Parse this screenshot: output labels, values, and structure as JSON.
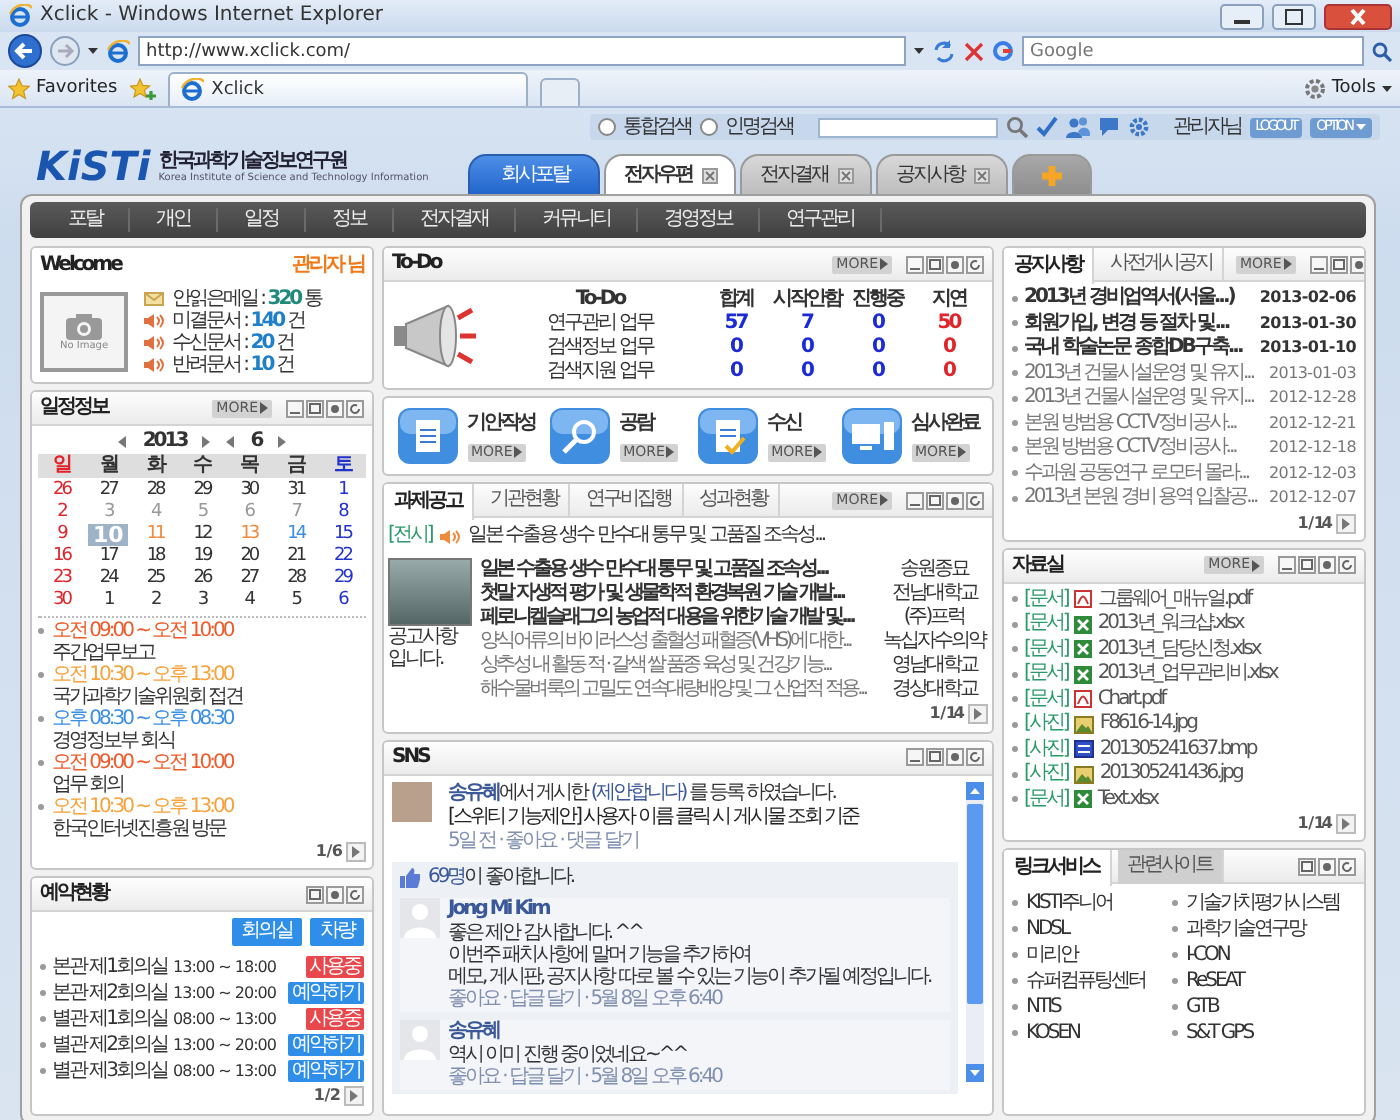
{
  "browser": {
    "title": "Xclick - Windows Internet Explorer",
    "address": "http://www.xclick.com/",
    "search_placeholder": "Google",
    "favorites": "Favorites",
    "tab": "Xclick",
    "tools": "Tools"
  },
  "topbar": {
    "search_options": [
      {
        "label": "통합검색",
        "selected": false
      },
      {
        "label": "인명검색",
        "selected": false
      }
    ],
    "user": "관리자님",
    "logout": "LOGOUT",
    "option": "OPTION"
  },
  "logo": {
    "mark": "KiSTi",
    "name": "한국과학기술정보연구원",
    "subtitle": "Korea Institute of Science and Technology Information"
  },
  "portal_tabs": [
    {
      "kind": "home",
      "label": "회사포탈",
      "selected": false
    },
    {
      "kind": "tab",
      "label": "전자우편",
      "selected": true
    },
    {
      "kind": "tab",
      "label": "전자결재",
      "selected": false
    },
    {
      "kind": "tab",
      "label": "공지사항",
      "selected": false
    },
    {
      "kind": "add"
    }
  ],
  "menu": [
    "포탈",
    "개인",
    "일정",
    "정보",
    "전자결재",
    "커뮤니티",
    "경영정보",
    "연구관리"
  ],
  "welcome": {
    "title": "Welcome",
    "user": "관리자 님",
    "photo_caption": "No Image",
    "stats": [
      {
        "kind": "mail",
        "label": "안읽은메일 : ",
        "value": "320",
        "unit": " 통",
        "color": "#1f8a7a"
      },
      {
        "kind": "speaker",
        "label": "미결문서 : ",
        "value": "140",
        "unit": " 건",
        "color": "#1f7fc8"
      },
      {
        "kind": "speaker",
        "label": "수신문서 : ",
        "value": "20",
        "unit": " 건",
        "color": "#1f7fc8"
      },
      {
        "kind": "speaker",
        "label": "반려문서 : ",
        "value": "10",
        "unit": " 건",
        "color": "#1f7fc8"
      }
    ]
  },
  "schedule": {
    "title": "일정정보",
    "more": "MORE",
    "year": "2013",
    "month": "6",
    "weekdays": [
      {
        "label": "일",
        "color": "#e0242b"
      },
      {
        "label": "월",
        "color": "#333333"
      },
      {
        "label": "화",
        "color": "#333333"
      },
      {
        "label": "수",
        "color": "#333333"
      },
      {
        "label": "목",
        "color": "#333333"
      },
      {
        "label": "금",
        "color": "#333333"
      },
      {
        "label": "토",
        "color": "#2233cc"
      }
    ],
    "weeks": [
      [
        {
          "day": "26",
          "color": "#e0242b",
          "selected": false
        },
        {
          "day": "27",
          "color": "#333333",
          "selected": false
        },
        {
          "day": "28",
          "color": "#333333",
          "selected": false
        },
        {
          "day": "29",
          "color": "#333333",
          "selected": false
        },
        {
          "day": "30",
          "color": "#333333",
          "selected": false
        },
        {
          "day": "31",
          "color": "#333333",
          "selected": false
        },
        {
          "day": "1",
          "color": "#2233cc",
          "selected": false
        }
      ],
      [
        {
          "day": "2",
          "color": "#e0242b",
          "selected": false
        },
        {
          "day": "3",
          "color": "#999999",
          "selected": false
        },
        {
          "day": "4",
          "color": "#999999",
          "selected": false
        },
        {
          "day": "5",
          "color": "#999999",
          "selected": false
        },
        {
          "day": "6",
          "color": "#999999",
          "selected": false
        },
        {
          "day": "7",
          "color": "#999999",
          "selected": false
        },
        {
          "day": "8",
          "color": "#2233cc",
          "selected": false
        }
      ],
      [
        {
          "day": "9",
          "color": "#e0242b",
          "selected": false
        },
        {
          "day": "10",
          "selected": true
        },
        {
          "day": "11",
          "color": "#f08a3c",
          "selected": false
        },
        {
          "day": "12",
          "color": "#333333",
          "selected": false
        },
        {
          "day": "13",
          "color": "#f08a3c",
          "selected": false
        },
        {
          "day": "14",
          "color": "#3a8ee6",
          "selected": false
        },
        {
          "day": "15",
          "color": "#2233cc",
          "selected": false
        }
      ],
      [
        {
          "day": "16",
          "color": "#e0242b",
          "selected": false
        },
        {
          "day": "17",
          "color": "#333333",
          "selected": false
        },
        {
          "day": "18",
          "color": "#333333",
          "selected": false
        },
        {
          "day": "19",
          "color": "#333333",
          "selected": false
        },
        {
          "day": "20",
          "color": "#333333",
          "selected": false
        },
        {
          "day": "21",
          "color": "#333333",
          "selected": false
        },
        {
          "day": "22",
          "color": "#2233cc",
          "selected": false
        }
      ],
      [
        {
          "day": "23",
          "color": "#e0242b",
          "selected": false
        },
        {
          "day": "24",
          "color": "#333333",
          "selected": false
        },
        {
          "day": "25",
          "color": "#333333",
          "selected": false
        },
        {
          "day": "26",
          "color": "#333333",
          "selected": false
        },
        {
          "day": "27",
          "color": "#333333",
          "selected": false
        },
        {
          "day": "28",
          "color": "#333333",
          "selected": false
        },
        {
          "day": "29",
          "color": "#2233cc",
          "selected": false
        }
      ],
      [
        {
          "day": "30",
          "color": "#e0242b",
          "selected": false
        },
        {
          "day": "1",
          "color": "#333333",
          "selected": false
        },
        {
          "day": "2",
          "color": "#333333",
          "selected": false
        },
        {
          "day": "3",
          "color": "#333333",
          "selected": false
        },
        {
          "day": "4",
          "color": "#333333",
          "selected": false
        },
        {
          "day": "5",
          "color": "#333333",
          "selected": false
        },
        {
          "day": "6",
          "color": "#2233cc",
          "selected": false
        }
      ]
    ],
    "events": [
      {
        "time": "오전 09:00 ~ 오전 10:00",
        "title": "주간업무보고",
        "color": "#f05a28"
      },
      {
        "time": "오전 10:30 ~ 오후 13:00",
        "title": "국가과학기술위원회 접견",
        "color": "#f7a23b"
      },
      {
        "time": "오후 08:30 ~ 오후 08:30",
        "title": "경영정보부 회식",
        "color": "#3a8ee6"
      },
      {
        "time": "오전 09:00 ~ 오전 10:00",
        "title": "업무 회의",
        "color": "#f05a28"
      },
      {
        "time": "오전 10:30 ~ 오후 13:00",
        "title": "한국인터넷진흥원 방문",
        "color": "#f7a23b"
      }
    ],
    "pager": "1 / 6"
  },
  "reservations": {
    "title": "예약현황",
    "buttons": [
      "회의실",
      "차량"
    ],
    "items": [
      {
        "room": "본관 제1회의실",
        "time": "13:00 ~ 18:00",
        "status": "사용중",
        "kind": "busy"
      },
      {
        "room": "본관 제2회의실",
        "time": "13:00 ~ 20:00",
        "status": "예약하기",
        "kind": "free"
      },
      {
        "room": "별관 제1회의실",
        "time": "08:00 ~ 13:00",
        "status": "사용중",
        "kind": "busy"
      },
      {
        "room": "별관 제2회의실",
        "time": "13:00 ~ 20:00",
        "status": "예약하기",
        "kind": "free"
      },
      {
        "room": "별관 제3회의실",
        "time": "08:00 ~ 13:00",
        "status": "예약하기",
        "kind": "free"
      }
    ],
    "pager": "1 / 2"
  },
  "todo": {
    "title": "To-Do",
    "more": "MORE",
    "header": "To-Do",
    "columns": [
      {
        "label": "합계",
        "color": "#1a2bd6"
      },
      {
        "label": "시작안함",
        "color": "#1a2bd6"
      },
      {
        "label": "진행중",
        "color": "#1a2bd6"
      },
      {
        "label": "지연",
        "color": "#e0242b"
      }
    ],
    "rows": [
      {
        "label": "연구관리 업무",
        "values": [
          "57",
          "7",
          "0",
          "50"
        ]
      },
      {
        "label": "검색정보 업무",
        "values": [
          "0",
          "0",
          "0",
          "0"
        ]
      },
      {
        "label": "검색지원 업무",
        "values": [
          "0",
          "0",
          "0",
          "0"
        ]
      }
    ]
  },
  "quick_links": [
    {
      "kind": "clipboard",
      "label": "기안작성",
      "more": "MORE"
    },
    {
      "kind": "search",
      "label": "공람",
      "more": "MORE"
    },
    {
      "kind": "clipboard-check",
      "label": "수신",
      "more": "MORE"
    },
    {
      "kind": "computer",
      "label": "심사완료",
      "more": "MORE"
    }
  ],
  "projects": {
    "tabs": [
      {
        "label": "과제공고",
        "selected": true
      },
      {
        "label": "기관현황",
        "selected": false
      },
      {
        "label": "연구비집행",
        "selected": false
      },
      {
        "label": "성과현황",
        "selected": false
      }
    ],
    "more": "MORE",
    "notice": {
      "tag": "[전시]",
      "text": "일본 수출용 생수 만수대 통무 및 고품질 조속성..."
    },
    "photo_caption": "공고사항 입니다.",
    "items": [
      {
        "title": "일본 수출용 생수 만수대 통무 및 고품질 조속성...",
        "org": "송원종묘",
        "unread": true
      },
      {
        "title": "첫말 자생적 평가 및 생물학적 환경복원 기술 개발...",
        "org": "전남대학교",
        "unread": true
      },
      {
        "title": "페로니켈슬래그의 농업적 대용을 위한기술 개발 및...",
        "org": "(주)프럭",
        "unread": true
      },
      {
        "title": "양식어류의 바이러스성 출혈성 패혈증(VHS)에 대한...",
        "org": "녹십자수의약",
        "unread": false
      },
      {
        "title": "상추성 내 활동 적 · 갈색 쌀 품종 육성 및 건강기능...",
        "org": "영남대학교",
        "unread": false
      },
      {
        "title": "해수물벼룩의 고밀도 연속대량배양 및 그 산업적 적용...",
        "org": "경상대학교",
        "unread": false
      }
    ],
    "pager": "1 / 14"
  },
  "sns": {
    "title": "SNS",
    "post": {
      "author": "송유혜",
      "verb": "에서 게시한 ",
      "topic": "(제안합니다)",
      "action": " 를 등록 하였습니다.",
      "text": "[스위티 기능제안] 사용자 이름 클릭 시 게시물 조회 기준",
      "meta": "5일 전 · 좋아요 · 댓글 달기"
    },
    "likes": {
      "count": "69명",
      "text": "이 좋아합니다."
    },
    "comments": [
      {
        "author": "Jong Mi Kim",
        "lines": [
          "좋은 제안 감사합니다. ^^",
          "이번주 패치사항에 말머 기능을 추가하여",
          "메모, 게시판, 공지사항 따로 볼 수 있는 기능이 추가될 예정입니다."
        ],
        "meta": "좋아요 · 답글 달기 · 5월 8일 오후 6:40"
      },
      {
        "author": "송유혜",
        "lines": [
          "역시 이미 진행 중이었네요~^^"
        ],
        "meta": "좋아요 · 답글 달기 · 5월 8일 오후 6:40"
      }
    ]
  },
  "notices": {
    "tabs": [
      {
        "label": "공지사항",
        "selected": true
      },
      {
        "label": "사전게시공지",
        "selected": false
      }
    ],
    "more": "MORE",
    "items": [
      {
        "title": "2013년 경비업역서(서울...)",
        "date": "2013-02-06",
        "unread": true
      },
      {
        "title": "회원가입, 변경 등 절차 및...",
        "date": "2013-01-30",
        "unread": true
      },
      {
        "title": "국내 학술논문 종합DB구축...",
        "date": "2013-01-10",
        "unread": true
      },
      {
        "title": "2013년 건물시설운영 및 유지...",
        "date": "2013-01-03",
        "unread": false
      },
      {
        "title": "2013년 건물시설운영 및 유지...",
        "date": "2012-12-28",
        "unread": false
      },
      {
        "title": "본원 방범용 CCTV정비공사...",
        "date": "2012-12-21",
        "unread": false
      },
      {
        "title": "본원 방범용 CCTV정비공사...",
        "date": "2012-12-18",
        "unread": false
      },
      {
        "title": "수과원 공동연구 로모터 몰라...",
        "date": "2012-12-03",
        "unread": false
      },
      {
        "title": "2013년 본원 경비 용역 입찰공...",
        "date": "2012-12-07",
        "unread": false
      }
    ],
    "pager": "1 / 14"
  },
  "archive": {
    "title": "자료실",
    "more": "MORE",
    "items": [
      {
        "tag": "[문서]",
        "kind": "pdf",
        "name": "그룹웨어_매뉴얼.pdf"
      },
      {
        "tag": "[문서]",
        "kind": "xls",
        "name": "2013년_워크샵.xlsx"
      },
      {
        "tag": "[문서]",
        "kind": "xls",
        "name": "2013년_담당신청.xlsx"
      },
      {
        "tag": "[문서]",
        "kind": "xls",
        "name": "2013년_업무관리비.xlsx"
      },
      {
        "tag": "[문서]",
        "kind": "pdf",
        "name": "Chart.pdf"
      },
      {
        "tag": "[사진]",
        "kind": "image",
        "name": "F8616-14.jpg"
      },
      {
        "tag": "[사진]",
        "kind": "bmp",
        "name": "201305241637.bmp"
      },
      {
        "tag": "[사진]",
        "kind": "image",
        "name": "201305241436.jpg"
      },
      {
        "tag": "[문서]",
        "kind": "xls",
        "name": "Text.xlsx"
      }
    ],
    "pager": "1 / 14"
  },
  "links": {
    "tabs": [
      {
        "label": "링크서비스",
        "selected": true
      },
      {
        "label": "관련사이트",
        "selected": false
      }
    ],
    "items": [
      "KISTI주니어",
      "기술가치평가시스템",
      "NDSL",
      "과학기술연구망",
      "미리안",
      "I-CON",
      "슈퍼컴퓨팅센터",
      "ReSEAT",
      "NTIS",
      "GTB",
      "KOSEN",
      "S&T GPS"
    ]
  }
}
